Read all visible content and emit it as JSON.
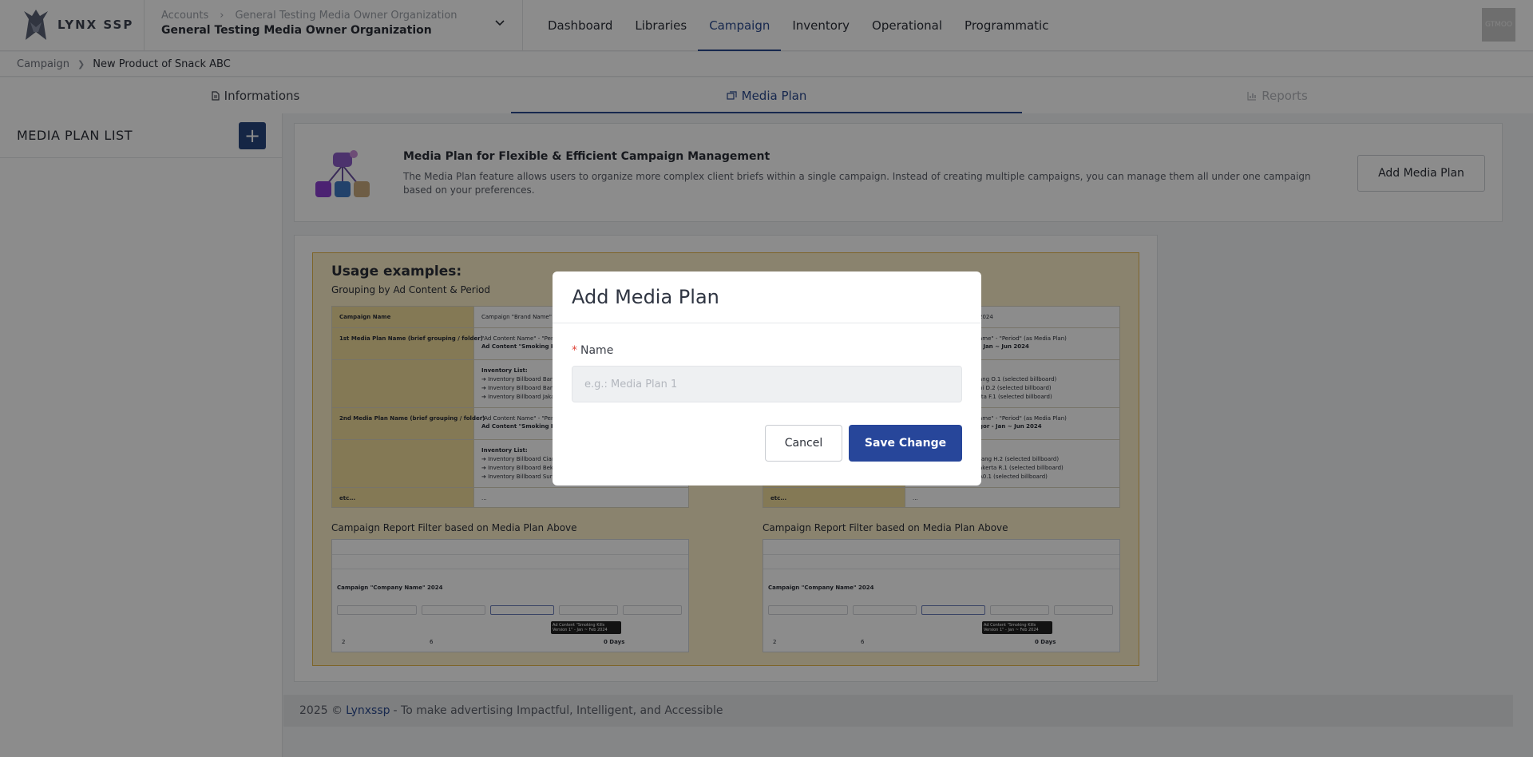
{
  "header": {
    "logo_text": "LYNX SSP",
    "org_crumb_root": "Accounts",
    "org_crumb_child": "General Testing Media Owner Organization",
    "org_name": "General Testing Media Owner Organization",
    "nav": [
      "Dashboard",
      "Libraries",
      "Campaign",
      "Inventory",
      "Operational",
      "Programmatic"
    ],
    "nav_active": "Campaign",
    "avatar_text": "GTMOO"
  },
  "breadcrumb": {
    "root": "Campaign",
    "current": "New Product of Snack ABC"
  },
  "tabs": {
    "informations": "Informations",
    "media_plan": "Media Plan",
    "reports": "Reports"
  },
  "sidebar": {
    "title": "MEDIA PLAN LIST",
    "add_label": "+"
  },
  "info": {
    "title": "Media Plan for Flexible & Efficient Campaign Management",
    "desc": "The Media Plan feature allows users to organize more complex client briefs within a single campaign. Instead of creating multiple campaigns, you can manage them all under one campaign based on your preferences.",
    "add_button": "Add Media Plan"
  },
  "usage": {
    "title": "Usage examples:",
    "subtitle": "Grouping by Ad Content & Period",
    "table_left": {
      "header_a": "Campaign Name",
      "header_b": "Campaign \"Brand Name\" 20",
      "row1_a": "1st Media Plan Name (brief grouping / folder)",
      "row1_b1": "\"Ad Content Name\" - \"Perio",
      "row1_b2": "Ad Content \"Smoking Kills",
      "row1_inv": "Inventory List:",
      "row1_i1": "➔ Inventory Billboard Band",
      "row1_i2": "➔ Inventory Billboard Band",
      "row1_i3": "➔ Inventory Billboard Jakar",
      "row2_a": "2nd Media Plan Name (brief grouping / folder)",
      "row2_b1": "\"Ad Content Name\" - \"Perio",
      "row2_b2": "Ad Content \"Smoking Kills",
      "row2_inv": "Inventory List:",
      "row2_i1": "➔ Inventory Billboard Cianj",
      "row2_i2": "➔ Inventory Billboard Beka",
      "row2_i3": "➔ Inventory Billboard Surat",
      "etc_a": "etc...",
      "etc_b": "..."
    },
    "table_right": {
      "header_b": "2024",
      "row1_b1": "ame\" - \"Period\" (as Media Plan)",
      "row1_b2": "- Jan ~ Jun 2024",
      "row1_i1": "ang O.1 (selected billboard)",
      "row1_i2": "ni D.2 (selected billboard)",
      "row1_i3": "rta F.1 (selected billboard)",
      "row2_b1": "ame\" - \"Period\" (as Media Plan)",
      "row2_b2": "gor - Jan ~ Jun 2024",
      "row2_i1": "rang H.2 (selected billboard)",
      "row2_i2": "akerta R.1 (selected billboard)",
      "row2_i3": "A0.1 (selected billboard)",
      "etc_a": "etc...",
      "etc_b": "..."
    },
    "report_label": "Campaign Report Filter based on Media Plan Above",
    "report": {
      "campaign_title": "Campaign \"Company Name\" 2024",
      "tooltip": "Ad Content \"Smoking Kills Version 1\" - Jan ~ Feb 2024",
      "stat_1": "2",
      "stat_2": "6",
      "stat_3": "0 Days"
    }
  },
  "footer": {
    "year": "2025 ©",
    "brand": "Lynxssp",
    "tagline": "- To make advertising Impactful, Intelligent, and Accessible"
  },
  "modal": {
    "title": "Add Media Plan",
    "required_mark": "*",
    "name_label": "Name",
    "name_placeholder": "e.g.: Media Plan 1",
    "name_value": "",
    "cancel_label": "Cancel",
    "save_label": "Save Change"
  },
  "colors": {
    "primary": "#27469a",
    "nav_active": "#2a4a8f",
    "required": "#e0463b",
    "usage_bg": "#fbeec9",
    "usage_border": "#e6b84b"
  }
}
